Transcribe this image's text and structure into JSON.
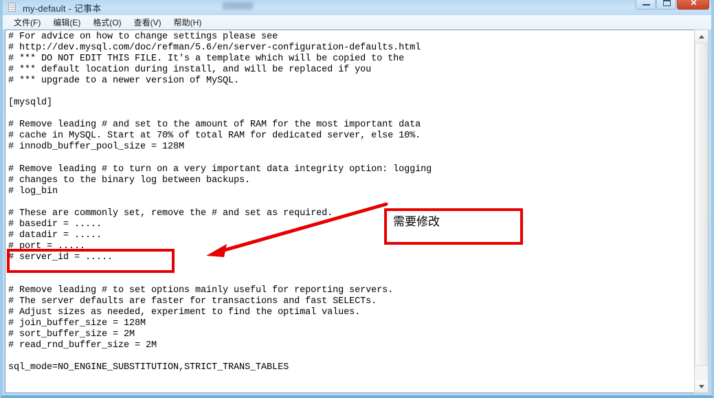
{
  "window": {
    "title": "my-default - 记事本",
    "icon": "notepad-document-icon",
    "controls": {
      "minimize": "–",
      "maximize": "□",
      "close": "✕"
    }
  },
  "menubar": {
    "items": [
      {
        "label": "文件(F)",
        "name": "menu-file"
      },
      {
        "label": "编辑(E)",
        "name": "menu-edit"
      },
      {
        "label": "格式(O)",
        "name": "menu-format"
      },
      {
        "label": "查看(V)",
        "name": "menu-view"
      },
      {
        "label": "帮助(H)",
        "name": "menu-help"
      }
    ]
  },
  "editor": {
    "content": "# For advice on how to change settings please see\n# http://dev.mysql.com/doc/refman/5.6/en/server-configuration-defaults.html\n# *** DO NOT EDIT THIS FILE. It's a template which will be copied to the\n# *** default location during install, and will be replaced if you\n# *** upgrade to a newer version of MySQL.\n\n[mysqld]\n\n# Remove leading # and set to the amount of RAM for the most important data\n# cache in MySQL. Start at 70% of total RAM for dedicated server, else 10%.\n# innodb_buffer_pool_size = 128M\n\n# Remove leading # to turn on a very important data integrity option: logging\n# changes to the binary log between backups.\n# log_bin\n\n# These are commonly set, remove the # and set as required.\n# basedir = .....\n# datadir = .....\n# port = .....\n# server_id = .....\n\n\n# Remove leading # to set options mainly useful for reporting servers.\n# The server defaults are faster for transactions and fast SELECTs.\n# Adjust sizes as needed, experiment to find the optimal values.\n# join_buffer_size = 128M\n# sort_buffer_size = 2M\n# read_rnd_buffer_size = 2M\n\nsql_mode=NO_ENGINE_SUBSTITUTION,STRICT_TRANS_TABLES"
  },
  "annotations": {
    "note_label": "需要修改",
    "accent_color": "#e60000",
    "highlighted_lines": [
      "# basedir = .....",
      "# datadir = ....."
    ]
  },
  "scrollbar": {
    "up_arrow": "▲",
    "down_arrow": "▼"
  }
}
